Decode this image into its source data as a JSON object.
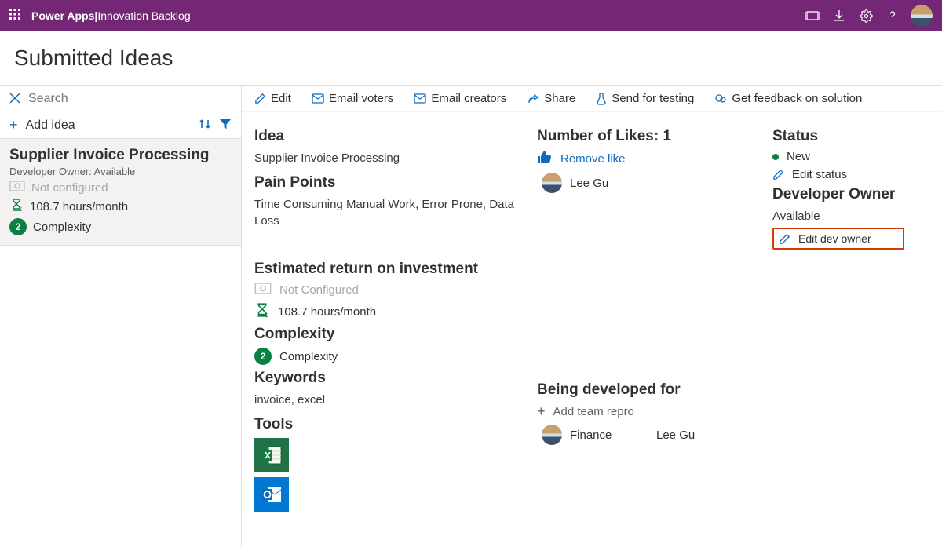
{
  "header": {
    "product": "Power Apps",
    "separator": "  |  ",
    "app": "Innovation Backlog"
  },
  "page_title": "Submitted Ideas",
  "search": {
    "placeholder": "Search"
  },
  "add_idea_label": "Add idea",
  "idea_card": {
    "title": "Supplier Invoice Processing",
    "owner_line": "Developer Owner: Available",
    "not_configured": "Not configured",
    "hours": "108.7 hours/month",
    "complexity_badge": "2",
    "complexity_label": "Complexity"
  },
  "toolbar": {
    "edit": "Edit",
    "email_voters": "Email voters",
    "email_creators": "Email creators",
    "share": "Share",
    "send_testing": "Send for testing",
    "feedback": "Get feedback on solution"
  },
  "detail": {
    "idea_heading": "Idea",
    "idea_title": "Supplier Invoice Processing",
    "pain_heading": "Pain Points",
    "pain_body": "Time Consuming Manual Work, Error Prone, Data Loss",
    "roi_heading": "Estimated return on investment",
    "roi_not_configured": "Not Configured",
    "roi_hours": "108.7 hours/month",
    "complexity_heading": "Complexity",
    "complexity_badge": "2",
    "complexity_label": "Complexity",
    "keywords_heading": "Keywords",
    "keywords_body": "invoice, excel",
    "tools_heading": "Tools",
    "likes_heading": "Number of Likes: 1",
    "remove_like": "Remove like",
    "liker_name": "Lee Gu",
    "dev_for_heading": "Being developed for",
    "add_team_repro": "Add team repro",
    "team_name": "Finance",
    "team_owner": "Lee Gu",
    "status_heading": "Status",
    "status_value": "New",
    "edit_status": "Edit status",
    "dev_owner_heading": "Developer Owner",
    "dev_owner_value": "Available",
    "edit_dev_owner": "Edit dev owner"
  }
}
